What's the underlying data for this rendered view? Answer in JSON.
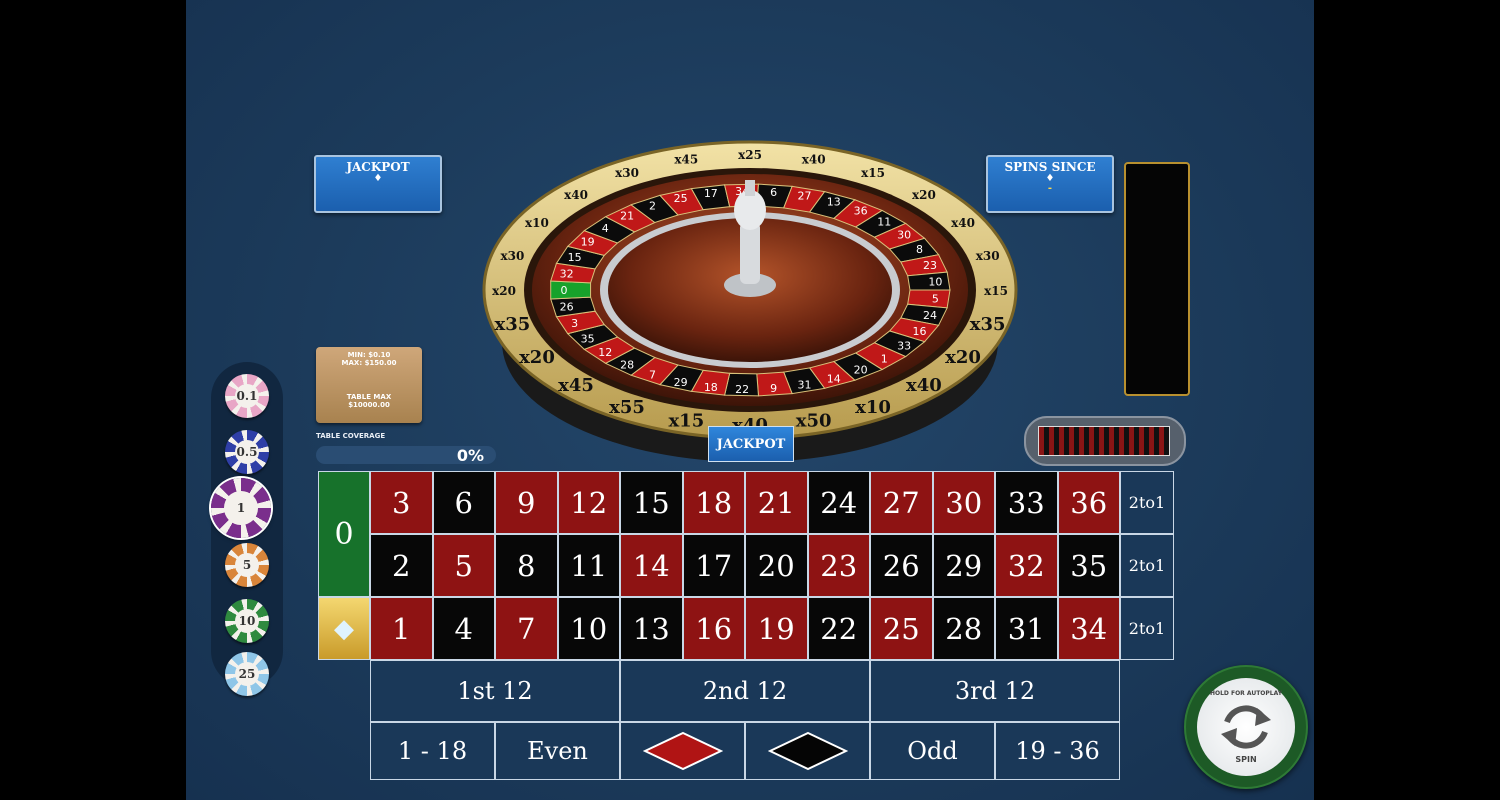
{
  "jackpot_panel": {
    "title": "JACKPOT"
  },
  "spins_since_panel": {
    "title": "SPINS SINCE",
    "value": "-"
  },
  "limits_plaque": {
    "line1": "MIN: $0.10",
    "line2": "MAX: $150.00",
    "line3": "TABLE MAX",
    "line4": "$10000.00"
  },
  "coverage": {
    "label": "TABLE COVERAGE",
    "percent": "0%"
  },
  "chips": [
    {
      "value": "0.1",
      "color": "#e8a6c6"
    },
    {
      "value": "0.5",
      "color": "#2f3fa7"
    },
    {
      "value": "1",
      "color": "#7a2e8c",
      "selected": true
    },
    {
      "value": "5",
      "color": "#d9853a"
    },
    {
      "value": "10",
      "color": "#2f8a3f"
    },
    {
      "value": "25",
      "color": "#8fc6e8"
    }
  ],
  "wheel": {
    "multiplier_labels": [
      "x40",
      "x15",
      "x55",
      "x45",
      "x20",
      "x35",
      "x20",
      "x30",
      "x10",
      "x40",
      "x30",
      "x45",
      "x25",
      "x40",
      "x15",
      "x20",
      "x40",
      "x30",
      "x15",
      "x35",
      "x20",
      "x40",
      "x10",
      "x50"
    ],
    "jackpot_tab": "JACKPOT",
    "numbers_visible": [
      "5",
      "24",
      "16",
      "33",
      "1",
      "20",
      "14",
      "31",
      "9",
      "22",
      "18",
      "29",
      "7",
      "28",
      "12",
      "35",
      "3",
      "26",
      "0",
      "32",
      "15",
      "19",
      "4",
      "21",
      "2",
      "25",
      "17",
      "34",
      "6",
      "27",
      "13",
      "36",
      "11",
      "30",
      "8",
      "23",
      "10"
    ]
  },
  "board": {
    "zero": "0",
    "rows": [
      [
        {
          "n": "3",
          "c": "red"
        },
        {
          "n": "6",
          "c": "black"
        },
        {
          "n": "9",
          "c": "red"
        },
        {
          "n": "12",
          "c": "red"
        },
        {
          "n": "15",
          "c": "black"
        },
        {
          "n": "18",
          "c": "red"
        },
        {
          "n": "21",
          "c": "red"
        },
        {
          "n": "24",
          "c": "black"
        },
        {
          "n": "27",
          "c": "red"
        },
        {
          "n": "30",
          "c": "red"
        },
        {
          "n": "33",
          "c": "black"
        },
        {
          "n": "36",
          "c": "red"
        }
      ],
      [
        {
          "n": "2",
          "c": "black"
        },
        {
          "n": "5",
          "c": "red"
        },
        {
          "n": "8",
          "c": "black"
        },
        {
          "n": "11",
          "c": "black"
        },
        {
          "n": "14",
          "c": "red"
        },
        {
          "n": "17",
          "c": "black"
        },
        {
          "n": "20",
          "c": "black"
        },
        {
          "n": "23",
          "c": "red"
        },
        {
          "n": "26",
          "c": "black"
        },
        {
          "n": "29",
          "c": "black"
        },
        {
          "n": "32",
          "c": "red"
        },
        {
          "n": "35",
          "c": "black"
        }
      ],
      [
        {
          "n": "1",
          "c": "red"
        },
        {
          "n": "4",
          "c": "black"
        },
        {
          "n": "7",
          "c": "red"
        },
        {
          "n": "10",
          "c": "black"
        },
        {
          "n": "13",
          "c": "black"
        },
        {
          "n": "16",
          "c": "red"
        },
        {
          "n": "19",
          "c": "red"
        },
        {
          "n": "22",
          "c": "black"
        },
        {
          "n": "25",
          "c": "red"
        },
        {
          "n": "28",
          "c": "black"
        },
        {
          "n": "31",
          "c": "black"
        },
        {
          "n": "34",
          "c": "red"
        }
      ]
    ],
    "columns": [
      "2to1",
      "2to1",
      "2to1"
    ],
    "dozens": [
      "1st 12",
      "2nd 12",
      "3rd 12"
    ],
    "even_money": [
      "1 - 18",
      "Even",
      "red",
      "black",
      "Odd",
      "19 - 36"
    ]
  },
  "spin_button": {
    "top_text": "HOLD FOR AUTOPLAY",
    "bottom_text": "SPIN"
  },
  "colors": {
    "felt": "#1c3b5b",
    "red": "#8e1313",
    "black": "#070707",
    "green": "#17722b",
    "gold": "#d8c27a"
  }
}
